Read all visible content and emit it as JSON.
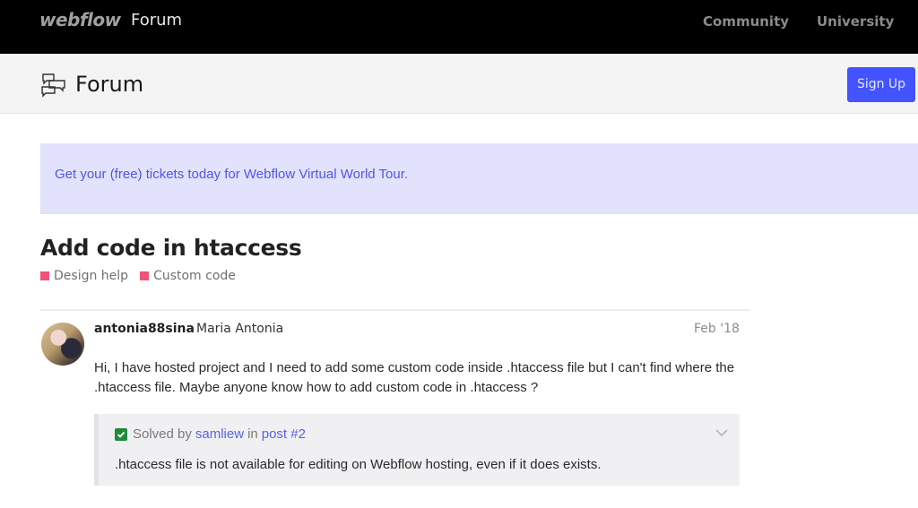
{
  "topbar": {
    "brand": "webflow",
    "brand_sub": "Forum",
    "nav": [
      "Community",
      "University"
    ]
  },
  "header": {
    "title": "Forum",
    "logo_icon": "chat-bubbles-icon",
    "signup_label": "Sign Up"
  },
  "colors": {
    "accent": "#4353ff",
    "banner_bg": "#e2e2fd",
    "category": "#f0527a",
    "solved_check": "#1e8a3a"
  },
  "banner": {
    "text": "Get your (free) tickets today for Webflow Virtual World Tour."
  },
  "topic": {
    "title": "Add code in htaccess",
    "categories": [
      "Design help",
      "Custom code"
    ]
  },
  "post": {
    "username": "antonia88sina",
    "full_name": "Maria Antonia",
    "date": "Feb '18",
    "body": "Hi, I have hosted project and I need to add some custom code inside .htaccess file but I can't find where the .htaccess file. Maybe anyone know how to add custom code in .htaccess ?",
    "solution": {
      "solved_by_label": "Solved by",
      "solver": "samliew",
      "in_label": "in",
      "post_link": "post #2",
      "excerpt": ".htaccess file is not available for editing on Webflow hosting, even if it does exists."
    }
  }
}
